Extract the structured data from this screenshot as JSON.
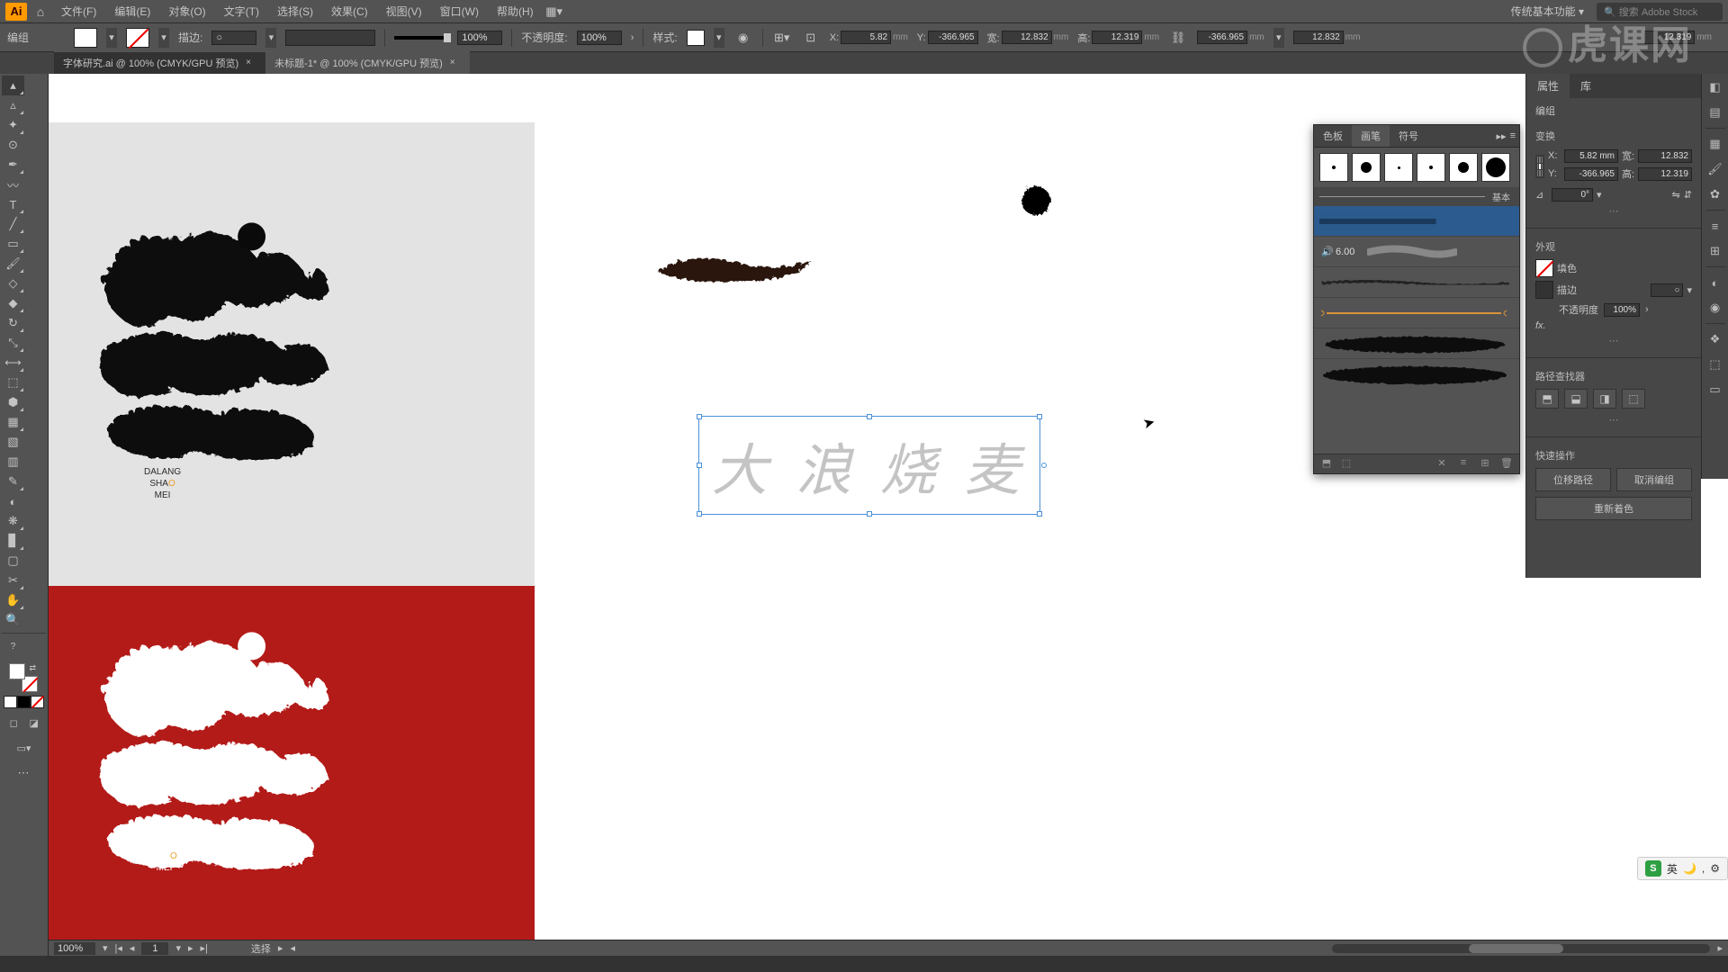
{
  "app": {
    "name": "Ai"
  },
  "menubar": {
    "items": [
      "文件(F)",
      "编辑(E)",
      "对象(O)",
      "文字(T)",
      "选择(S)",
      "效果(C)",
      "视图(V)",
      "窗口(W)",
      "帮助(H)"
    ],
    "workspace": "传统基本功能",
    "search_placeholder": "搜索 Adobe Stock"
  },
  "control": {
    "label": "编组",
    "stroke_label": "描边:",
    "scale": "100%",
    "opacity_label": "不透明度:",
    "opacity": "100%",
    "style_label": "样式:",
    "x_label": "X:",
    "x": "5.82",
    "x_unit": "mm",
    "y_label": "Y:",
    "y": "-366.965",
    "w_label": "宽:",
    "w": "12.832",
    "w_unit": "mm",
    "h_label": "高:",
    "h": "12.319",
    "h_unit": "mm",
    "link_x": "-366.965",
    "link_unit": "mm",
    "right_val": "12.832",
    "right_unit": "mm",
    "far_right": "12.319"
  },
  "tabs": [
    {
      "label": "字体研究.ai @ 100% (CMYK/GPU 预览)",
      "active": false
    },
    {
      "label": "未标题-1* @ 100% (CMYK/GPU 预览)",
      "active": true
    }
  ],
  "canvas": {
    "subtitle_1": "DALANG",
    "subtitle_2a": "SHA",
    "subtitle_2b": "O",
    "subtitle_3": "MEI",
    "selected_text": "大 浪 烧 麦"
  },
  "brushes": {
    "tabs": [
      "色板",
      "画笔",
      "符号"
    ],
    "active_tab": 1,
    "basic_label": "基本",
    "size_label": "6.00"
  },
  "props": {
    "tabs": [
      "属性",
      "库"
    ],
    "active_tab": 0,
    "obj_type": "编组",
    "transform_title": "变换",
    "x_label": "X:",
    "x": "5.82 mm",
    "y_label": "Y:",
    "y": "-366.965",
    "w_label": "宽:",
    "w": "12.832",
    "h_label": "高:",
    "h": "12.319",
    "angle": "0°",
    "appearance_title": "外观",
    "fill_label": "填色",
    "stroke_label": "描边",
    "opacity_label": "不透明度",
    "opacity": "100%",
    "pathfinder_title": "路径查找器",
    "quick_title": "快速操作",
    "btn1": "位移路径",
    "btn2": "取消编组",
    "btn3": "重新着色"
  },
  "status": {
    "zoom": "100%",
    "artboard": "1",
    "tool": "选择"
  },
  "watermark": "虎课网",
  "ime": {
    "lang": "英"
  }
}
